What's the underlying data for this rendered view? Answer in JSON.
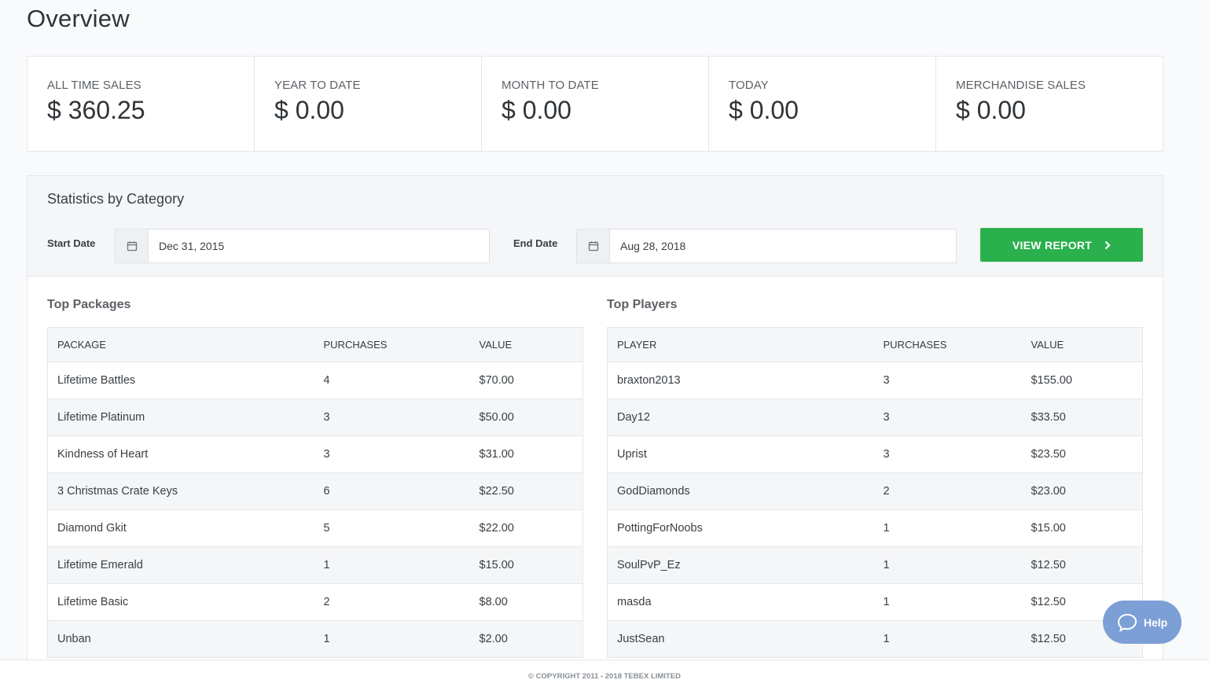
{
  "page": {
    "title": "Overview"
  },
  "stats": [
    {
      "label": "ALL TIME SALES",
      "value": "$ 360.25"
    },
    {
      "label": "YEAR TO DATE",
      "value": "$ 0.00"
    },
    {
      "label": "MONTH TO DATE",
      "value": "$ 0.00"
    },
    {
      "label": "TODAY",
      "value": "$ 0.00"
    },
    {
      "label": "MERCHANDISE SALES",
      "value": "$ 0.00"
    }
  ],
  "category": {
    "title": "Statistics by Category",
    "start_label": "Start Date",
    "start_value": "Dec 31, 2015",
    "end_label": "End Date",
    "end_value": "Aug 28, 2018",
    "button_label": "VIEW REPORT"
  },
  "packages": {
    "title": "Top Packages",
    "headers": [
      "PACKAGE",
      "PURCHASES",
      "VALUE"
    ],
    "rows": [
      [
        "Lifetime Battles",
        "4",
        "$70.00"
      ],
      [
        "Lifetime Platinum",
        "3",
        "$50.00"
      ],
      [
        "Kindness of Heart",
        "3",
        "$31.00"
      ],
      [
        "3 Christmas Crate Keys",
        "6",
        "$22.50"
      ],
      [
        "Diamond Gkit",
        "5",
        "$22.00"
      ],
      [
        "Lifetime Emerald",
        "1",
        "$15.00"
      ],
      [
        "Lifetime Basic",
        "2",
        "$8.00"
      ],
      [
        "Unban",
        "1",
        "$2.00"
      ]
    ]
  },
  "players": {
    "title": "Top Players",
    "headers": [
      "PLAYER",
      "PURCHASES",
      "VALUE"
    ],
    "rows": [
      [
        "braxton2013",
        "3",
        "$155.00"
      ],
      [
        "Day12",
        "3",
        "$33.50"
      ],
      [
        "Uprist",
        "3",
        "$23.50"
      ],
      [
        "GodDiamonds",
        "2",
        "$23.00"
      ],
      [
        "PottingForNoobs",
        "1",
        "$15.00"
      ],
      [
        "SoulPvP_Ez",
        "1",
        "$12.50"
      ],
      [
        "masda",
        "1",
        "$12.50"
      ],
      [
        "JustSean",
        "1",
        "$12.50"
      ]
    ]
  },
  "footer": {
    "text": "© COPYRIGHT 2011 - 2018 TEBEX LIMITED"
  },
  "help": {
    "label": "Help"
  }
}
